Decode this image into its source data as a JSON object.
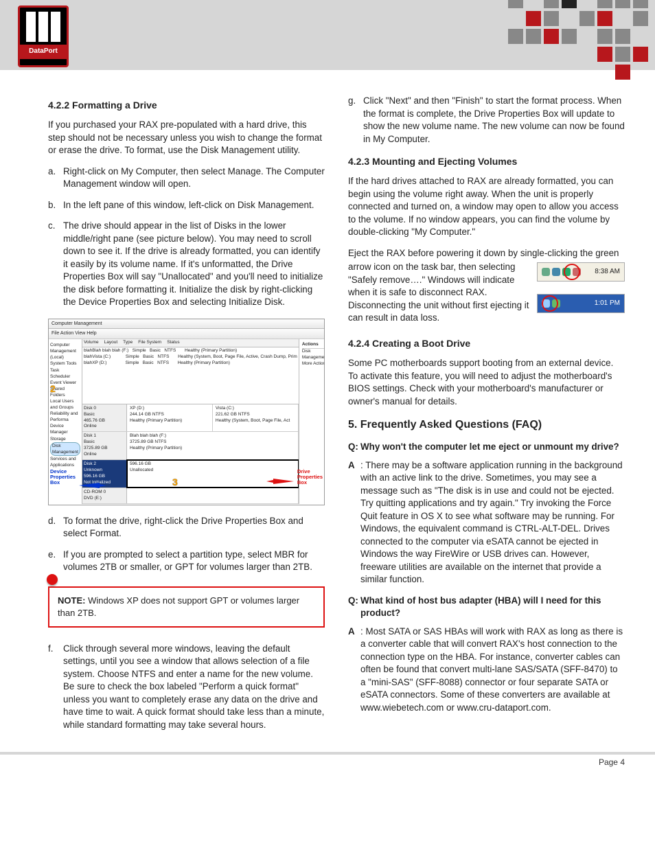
{
  "logo": {
    "sub": "DataPort"
  },
  "col1": {
    "h422": "4.2.2 Formatting a Drive",
    "p1": "If you purchased your RAX pre-populated with a hard drive, this step should not be necessary unless you wish to change the format or erase the drive.  To format, use the Disk Management utility.",
    "a": "Right-click on My Computer, then select Manage.  The Computer Management window will open.",
    "b": "In the left pane of this window, left-click on Disk Management.",
    "c": "The drive should appear in the list of Disks in the lower middle/right pane (see picture below).  You may need to scroll down to see it.  If the drive is already formatted, you can identify it easily by its volume name.  If it's unformatted, the Drive Properties Box will say \"Unallocated\" and you'll need to initialize the disk before formatting it.  Initialize the disk by right-clicking the Device Properties Box and selecting Initialize Disk.",
    "d": "To format the drive, right-click the Drive Properties Box and select Format.",
    "e": "If you are prompted to select a partition type, select MBR for volumes 2TB or smaller, or GPT for volumes larger than 2TB.",
    "note_label": "NOTE:",
    "note": "  Windows XP does not support GPT or volumes larger than 2TB.",
    "f": "Click through several more windows, leaving the default settings, until you see a window that allows selection of a file system.  Choose NTFS and enter a name for the new volume.  Be sure to check the box labeled \"Perform a quick format\" unless you want to completely erase any data on the drive and have time to wait.  A quick format should take less than a minute, while standard formatting may take several hours."
  },
  "fig": {
    "title": "Computer Management",
    "menu": "File   Action   View   Help",
    "tree": [
      "Computer Management (Local)",
      "  System Tools",
      "    Task Scheduler",
      "    Event Viewer",
      "    Shared Folders",
      "    Local Users and Groups",
      "    Reliability and Performa",
      "    Device Manager",
      "  Storage",
      "    Disk Management",
      "  Services and Applications"
    ],
    "cols": [
      "Volume",
      "Layout",
      "Type",
      "File System",
      "Status"
    ],
    "rows": [
      "blahBlah blah blah (F:)   Simple   Basic   NTFS       Healthy (Primary Partition)",
      "blahVista (C:)            Simple   Basic   NTFS       Healthy (System, Boot, Page File, Active, Crash Dump, Prim",
      "blahXP (D:)               Simple   Basic   NTFS       Healthy (Primary Partition)"
    ],
    "actions_h": "Actions",
    "actions": [
      "Disk Management",
      "  More Actions"
    ],
    "disk0_h": "Disk 0\nBasic\n465.76 GB\nOnline",
    "disk0_a": "XP  (D:)\n244.14 GB NTFS\nHealthy (Primary Partition)",
    "disk0_b": "Vista  (C:)\n221.62 GB NTFS\nHealthy (System, Boot, Page File, Act",
    "disk1_h": "Disk 1\nBasic\n3725.89 GB\nOnline",
    "disk1_a": "Blah blah blah  (F:)\n3725.89 GB NTFS\nHealthy (Primary Partition)",
    "disk2_h": "Disk 2\nUnknown\n596.16 GB\nNot Initialized",
    "disk2_a": "596.16 GB\nUnallocated",
    "cd_h": "CD-ROM 0\nDVD (E:)",
    "callout_dev": "Device\nProperties\nBox",
    "callout_drv": "Drive\nProperties\nBox"
  },
  "col2": {
    "g": "Click \"Next\" and then \"Finish\" to start the format process.  When the format is complete, the Drive Properties Box will update to show the new volume name.  The new volume can now be found in My Computer.",
    "h423": "4.2.3 Mounting and Ejecting Volumes",
    "p2": "If the hard drives attached to RAX are already formatted, you can begin using the volume right away.  When the unit is properly connected and turned on, a window may open to allow you access to the volume.  If no window appears, you can find the volume by double-clicking \"My Computer.\"",
    "p3a": "Eject the RAX before powering it down by single-clicking the green",
    "p3b": "arrow icon on the task bar, then selecting \"Safely remove….\"  Windows will indicate when it is safe to disconnect RAX.  Disconnecting the unit without first ejecting it can result in data loss.",
    "tray1_time": "8:38 AM",
    "tray2_time": "1:01 PM",
    "h424": "4.2.4 Creating a Boot Drive",
    "p4": "Some PC motherboards support booting from an external device.  To activate this feature, you will need to adjust the motherboard's BIOS settings.  Check with your motherboard's manufacturer or owner's manual for details.",
    "h5": "5. Frequently Asked Questions (FAQ)",
    "q1": "Why won't the computer let me eject or unmount my drive?",
    "a1": ": There may be a software application running in the background with an active link to the drive. Sometimes, you may see a message such as \"The disk is in use and could not be ejected. Try quitting applications and try again.\"  Try invoking the Force Quit feature in OS X to see what software may be running. For Windows, the equivalent command is CTRL-ALT-DEL. Drives connected to the computer via eSATA cannot be ejected in Windows the way FireWire or USB drives can. However, freeware utilities are available on the internet that provide a similar function.",
    "q2": "What kind of host bus adapter (HBA) will I need for this product?",
    "a2": " Most SATA or SAS HBAs will work with RAX as long as there is a converter cable that will convert RAX's host connection to the connection type on the HBA.  For instance, converter cables can often be found that convert multi-lane SAS/SATA (SFF-8470) to a \"mini-SAS\" (SFF-8088) connector or four separate SATA or eSATA connectors.  Some of these converters are available at www.wiebetech.com or www.cru-dataport.com."
  },
  "labels": {
    "a": "a.",
    "b": "b.",
    "c": "c.",
    "d": "d.",
    "e": "e.",
    "f": "f.",
    "g": "g.",
    "Q": "Q:",
    "A": "A"
  },
  "footer": {
    "page": "Page 4"
  }
}
